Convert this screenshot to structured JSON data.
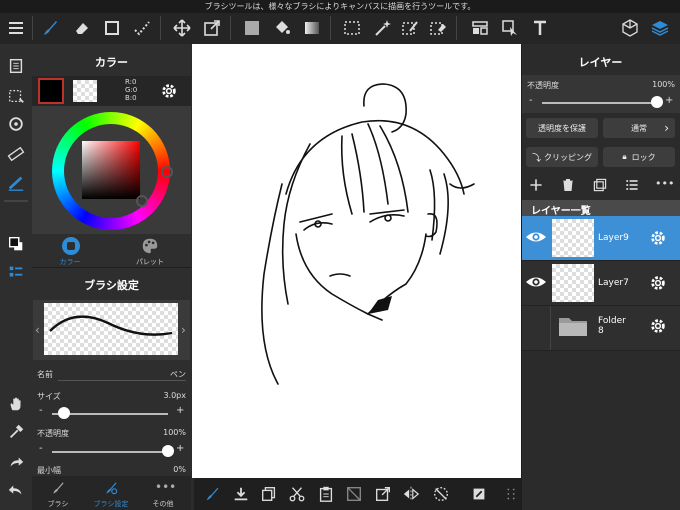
{
  "tooltip": "ブラシツールは、様々なブラシによりキャンバスに描画を行うツールです。",
  "color_panel": {
    "title": "カラー",
    "rgb": {
      "r": "R:0",
      "g": "G:0",
      "b": "B:0"
    },
    "tab_color": "カラー",
    "tab_palette": "パレット"
  },
  "brush_panel": {
    "title": "ブラシ設定",
    "name_label": "名前",
    "name_value": "ペン",
    "size_label": "サイズ",
    "size_value": "3.0px",
    "size_fraction": 0.1,
    "opacity_label": "不透明度",
    "opacity_value": "100%",
    "opacity_fraction": 1.0,
    "min_width_label": "最小幅",
    "min_width_value": "0%"
  },
  "bottom_tabs": {
    "brush": "ブラシ",
    "brush_settings": "ブラシ設定",
    "other": "その他"
  },
  "layer_panel": {
    "title": "レイヤー",
    "opacity_label": "不透明度",
    "opacity_value": "100%",
    "opacity_fraction": 1.0,
    "protect_alpha": "透明度を保護",
    "blend_mode": "通常",
    "clipping": "クリッピング",
    "lock": "ロック",
    "list_title": "レイヤー一覧",
    "layers": [
      {
        "name": "Layer9",
        "visible": true,
        "selected": true
      },
      {
        "name": "Layer7",
        "visible": true,
        "selected": false
      },
      {
        "name": "Folder\n8",
        "visible": false,
        "selected": false
      }
    ]
  },
  "colors": {
    "accent": "#2e8bd6",
    "selected_layer": "#3d8fd6",
    "primary_color": "#000000"
  }
}
